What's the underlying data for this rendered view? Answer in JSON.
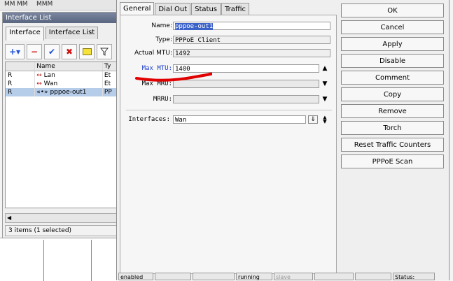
{
  "bg": {
    "col1": "MM",
    "col2": "MM",
    "col3": "MMM"
  },
  "interface_list": {
    "title": "Interface List",
    "tabs": [
      "Interface",
      "Interface List"
    ],
    "toolbar": [
      "add",
      "remove",
      "enable",
      "disable",
      "comment",
      "filter"
    ],
    "columns": [
      "",
      "Name",
      "Ty"
    ],
    "rows": [
      {
        "flag": "R",
        "name": "Lan",
        "type": "Et"
      },
      {
        "flag": "R",
        "name": "Wan",
        "type": "Et"
      },
      {
        "flag": "R",
        "name": "pppoe-out1",
        "type": "PP"
      }
    ],
    "status": "3 items (1 selected)"
  },
  "dialog": {
    "tabs": [
      "General",
      "Dial Out",
      "Status",
      "Traffic"
    ],
    "fields": {
      "name_label": "Name:",
      "name_value": "pppoe-out1",
      "type_label": "Type:",
      "type_value": "PPPoE Client",
      "actual_mtu_label": "Actual MTU:",
      "actual_mtu_value": "1492",
      "max_mtu_label": "Max MTU:",
      "max_mtu_value": "1400",
      "max_mru_label": "Max MRU:",
      "mrru_label": "MRRU:",
      "interfaces_label": "Interfaces:",
      "interfaces_value": "Wan"
    },
    "buttons": [
      "OK",
      "Cancel",
      "Apply",
      "Disable",
      "Comment",
      "Copy",
      "Remove",
      "Torch",
      "Reset Traffic Counters",
      "PPPoE Scan"
    ],
    "statusbar": [
      "enabled",
      "",
      "",
      "running",
      "slave",
      "",
      "",
      "Status:"
    ]
  },
  "colors": {
    "label_blue": "#1d3fcc",
    "selection": "#3b62c9",
    "annotation_red": "#e00000"
  }
}
